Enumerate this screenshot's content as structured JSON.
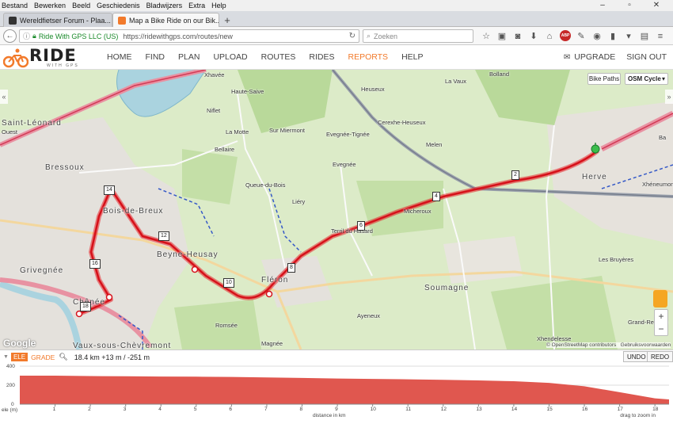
{
  "menubar": {
    "items": [
      "Bestand",
      "Bewerken",
      "Beeld",
      "Geschiedenis",
      "Bladwijzers",
      "Extra",
      "Help"
    ]
  },
  "tabs": [
    {
      "title": "Wereldfietser Forum - Plaa...",
      "active": false
    },
    {
      "title": "Map a Bike Ride on our Bik...",
      "active": true
    }
  ],
  "navbar": {
    "site_identity": "Ride With GPS LLC (US)",
    "url": "https://ridewithgps.com/routes/new",
    "search_placeholder": "Zoeken"
  },
  "site": {
    "logo_text": "RIDE",
    "logo_sub": "WITH GPS",
    "nav": [
      "HOME",
      "FIND",
      "PLAN",
      "UPLOAD",
      "ROUTES",
      "RIDES",
      "REPORTS",
      "HELP"
    ],
    "active_nav": "REPORTS",
    "upgrade": "UPGRADE",
    "signout": "SIGN OUT"
  },
  "map": {
    "layer_toggle": "Bike Paths",
    "basemap_select": "OSM Cycle",
    "places": [
      {
        "name": "Xhavée"
      },
      {
        "name": "Haute-Saive"
      },
      {
        "name": "Niflet"
      },
      {
        "name": "La Motte"
      },
      {
        "name": "Bellaire"
      },
      {
        "name": "Sur Miermont"
      },
      {
        "name": "Heuseux"
      },
      {
        "name": "Bolland"
      },
      {
        "name": "La Vaux"
      },
      {
        "name": "Cerexhe-Heuseux"
      },
      {
        "name": "Evegnée-Tignée"
      },
      {
        "name": "Melen"
      },
      {
        "name": "Evegnée"
      },
      {
        "name": "Queue-du-Bois"
      },
      {
        "name": "Liéry"
      },
      {
        "name": "Micheroux"
      },
      {
        "name": "Herve"
      },
      {
        "name": "Xhéneumont"
      },
      {
        "name": "Les Bruyères"
      },
      {
        "name": "Bressoux"
      },
      {
        "name": "Bois-de-Breux"
      },
      {
        "name": "Beyne-Heusay"
      },
      {
        "name": "Grivegnée"
      },
      {
        "name": "Fléron"
      },
      {
        "name": "Soumagne"
      },
      {
        "name": "Ayeneux"
      },
      {
        "name": "Romsée"
      },
      {
        "name": "Magnée"
      },
      {
        "name": "Xhendelesse"
      },
      {
        "name": "Grand-Rechain"
      },
      {
        "name": "Vaux-sous-Chèvremont"
      },
      {
        "name": "Chênée"
      },
      {
        "name": "Saint-Léonard"
      },
      {
        "name": "Ouest"
      },
      {
        "name": "Ba"
      },
      {
        "name": "Terril du Hasard"
      }
    ],
    "route_markers": [
      "2",
      "4",
      "6",
      "8",
      "10",
      "12",
      "14",
      "16",
      "18"
    ],
    "attribution": "© OpenStreetMap contributors",
    "user_contrib": "Gebruiksvoorwaarden",
    "google": "Google"
  },
  "elevation": {
    "tab_ele": "ELE",
    "tab_grade": "GRADE",
    "stats": "18.4 km +13 m / -251 m",
    "undo": "UNDO",
    "redo": "REDO",
    "y_ticks": [
      "400",
      "200",
      "0"
    ],
    "y_unit": "ele (m)",
    "x_ticks": [
      "1",
      "2",
      "3",
      "4",
      "5",
      "6",
      "7",
      "8",
      "9",
      "10",
      "11",
      "12",
      "13",
      "14",
      "15",
      "16",
      "17",
      "18"
    ],
    "x_label": "distance in km",
    "drag_hint": "drag to zoom in",
    "colors": {
      "fill": "#e0574f",
      "accent": "#f27a2b"
    }
  }
}
